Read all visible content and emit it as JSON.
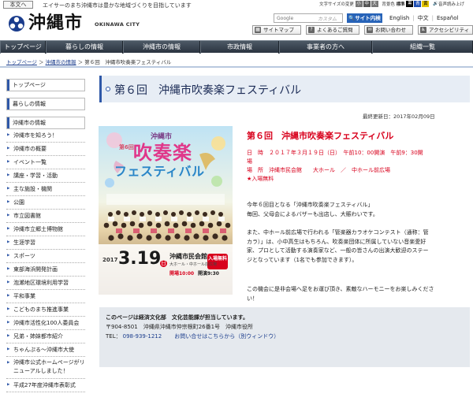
{
  "header": {
    "skip_link": "本文へ",
    "tagline": "エイサーのまち沖縄市は豊かな地域づくりを目指しています",
    "text_size_label": "文字サイズの変更",
    "text_sizes": [
      "小",
      "中",
      "大"
    ],
    "bg_color_label": "背景色",
    "bg_colors": [
      "標準",
      "黒",
      "青",
      "黄"
    ],
    "voice_label": "音声読み上げ",
    "city_name": "沖縄市",
    "city_name_en": "OKINAWA CITY",
    "search_placeholder": "Google",
    "search_custom": "カスタム",
    "search_button": "サイト内検索",
    "languages": [
      "English",
      "中文",
      "Español"
    ],
    "utility": [
      "サイトマップ",
      "よくあるご質問",
      "お問い合わせ",
      "アクセシビリティ"
    ]
  },
  "nav": [
    "トップページ",
    "暮らしの情報",
    "沖縄市の情報",
    "市政情報",
    "事業者の方へ",
    "組織一覧"
  ],
  "breadcrumb": [
    "トップページ",
    "沖縄市の情報",
    "第６回　沖縄市吹奏楽フェスティバル"
  ],
  "sidebar": {
    "heads": [
      "トップページ",
      "暮らしの情報",
      "沖縄市の情報"
    ],
    "items": [
      "沖縄市を知ろう！",
      "沖縄市の概要",
      "イベント一覧",
      "講座・学習・活動",
      "主な施設・機関",
      "公園",
      "市立図書館",
      "沖縄市立郷土博物館",
      "生涯学習",
      "スポーツ",
      "東部海浜開発計画",
      "泡瀬地区環境利用学習",
      "平和事業",
      "こどものまち推進事業",
      "沖縄市活性化100人委員会",
      "兄弟・姉妹都市紹介",
      "ちゃんぷる〜沖縄市大使"
    ],
    "tall_item": "沖縄市公式ホームページがリニューアルしました！",
    "last_item": "平成27年度沖縄市表彰式"
  },
  "page": {
    "title": "第６回　沖縄市吹奏楽フェスティバル",
    "updated": "最終更新日：2017年02月09日"
  },
  "poster": {
    "top_label": "沖縄市",
    "edition": "第6回",
    "title_line1": "吹奏楽",
    "title_line2": "フェスティバル",
    "year": "2017",
    "date": "3.19",
    "weekday": "日",
    "venue": "沖縄市民会館",
    "hall": "大ホール・中ホール前広場",
    "badge": "入場無料",
    "open": "開場10:00",
    "start": "開演9:30"
  },
  "event": {
    "title": "第６回　沖縄市吹奏楽フェスティバル",
    "date_line": "日　時　２０１７年３月１９日（日）　午前10：00開演　午前9：30開",
    "date_line2": "場",
    "venue_line": "場　所　沖縄市民会館　　大ホール　／　中ホール前広場",
    "free_line": "★入場無料"
  },
  "body": {
    "p1_l1": "今年６回目となる「沖縄市吹奏楽フェスティバル」",
    "p1_l2": "毎回、父母会によるバザーも出店し、大賑わいです。",
    "p2_l1": "また、中ホール前広場で行われる「管楽器カラオケコンテスト（通称：管",
    "p2_l2": "カラ）」は、小中高生はもちろん、吹奏楽団体に所属していない音楽愛好",
    "p2_l3": "家、プロとして活動する演奏家など、一般の皆さんの出演大歓迎のステー",
    "p2_l4": "ジとなっています（1名でも参加できます）。",
    "p3_l1": "この機会に是非会場へ足をお運び頂き、素敵なハーモニーをお楽しみくださ",
    "p3_l2": "い！"
  },
  "contact": {
    "heading": "このページは経済文化部　文化芸能課が担当しています。",
    "address": "〒904-8501　沖縄県沖縄市仲宗根町26番1号　沖縄市役所",
    "tel_label": "TEL：",
    "tel": "098-939-1212",
    "inquiry": "お問い合せはこちらから（別ウィンドウ）"
  },
  "colors": {
    "nav_bg": "#2b3440",
    "accent_blue": "#2f58a8",
    "event_red": "#d8001c",
    "contact_bg": "#e5e9ee"
  }
}
